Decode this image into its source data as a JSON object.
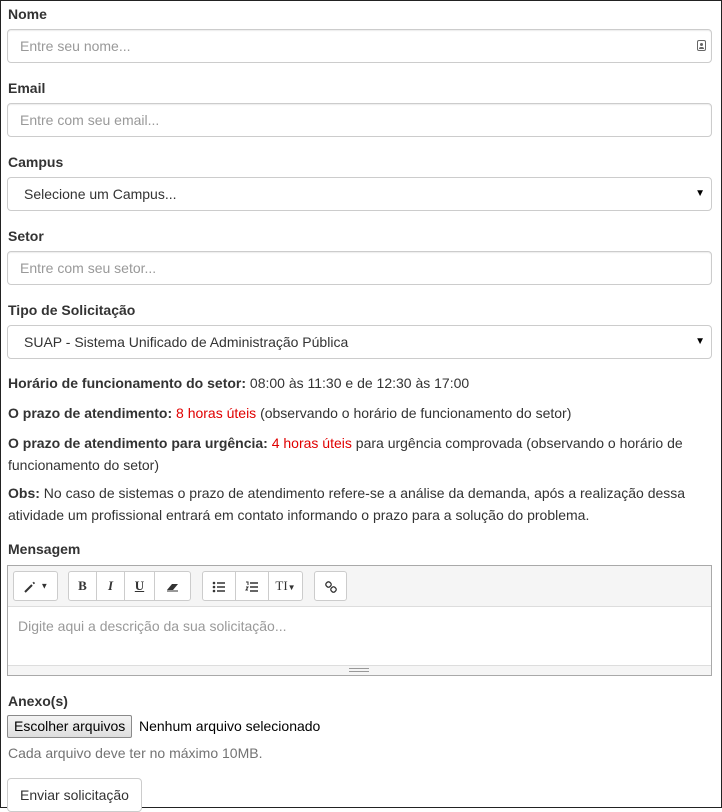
{
  "form": {
    "name": {
      "label": "Nome",
      "placeholder": "Entre seu nome..."
    },
    "email": {
      "label": "Email",
      "placeholder": "Entre com seu email..."
    },
    "campus": {
      "label": "Campus",
      "selected": "Selecione um Campus..."
    },
    "sector": {
      "label": "Setor",
      "placeholder": "Entre com seu setor..."
    },
    "request_type": {
      "label": "Tipo de Solicitação",
      "selected": "SUAP - Sistema Unificado de Administração Pública"
    }
  },
  "info": {
    "hours_label": "Horário de funcionamento do setor:",
    "hours_value": " 08:00 às 11:30 e de 12:30 às 17:00",
    "deadline_label": "O prazo de atendimento:",
    "deadline_highlight": " 8 horas úteis",
    "deadline_rest": " (observando o horário de funcionamento do setor)",
    "urgent_label": "O prazo de atendimento para urgência:",
    "urgent_highlight": " 4 horas úteis",
    "urgent_rest": " para urgência comprovada (observando o horário de funcionamento do setor)",
    "obs_label": "Obs:",
    "obs_text": " No caso de sistemas o prazo de atendimento refere-se a análise da demanda, após a realização dessa atividade um profissional entrará em contato informando o prazo para a solução do problema.",
    "highlight_color": "#e00000"
  },
  "message": {
    "label": "Mensagem",
    "placeholder": "Digite aqui a descrição da sua solicitação...",
    "toolbar": {
      "style_icon": "magic-wand-icon",
      "bold": "B",
      "italic": "I",
      "underline": "U",
      "eraser_icon": "eraser-icon",
      "ul_icon": "unordered-list-icon",
      "ol_icon": "ordered-list-icon",
      "height_label": "TI",
      "link_icon": "link-icon"
    }
  },
  "attachments": {
    "label": "Anexo(s)",
    "choose_button": "Escolher arquivos",
    "status": "Nenhum arquivo selecionado",
    "help": "Cada arquivo deve ter no máximo 10MB."
  },
  "submit_label": "Enviar solicitação"
}
